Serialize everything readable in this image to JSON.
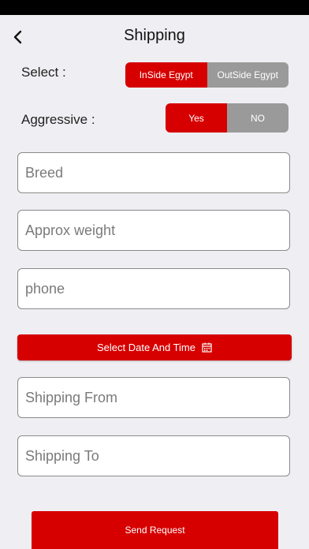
{
  "header": {
    "title": "Shipping"
  },
  "select_row": {
    "label": "Select :",
    "options": [
      "InSide Egypt",
      "OutSide Egypt"
    ],
    "selected": "InSide Egypt"
  },
  "aggressive_row": {
    "label": "Aggressive :",
    "options": [
      "Yes",
      "NO"
    ],
    "selected": "Yes"
  },
  "fields": {
    "breed": {
      "placeholder": "Breed",
      "value": ""
    },
    "weight": {
      "placeholder": "Approx weight",
      "value": ""
    },
    "phone": {
      "placeholder": "phone",
      "value": ""
    },
    "shipping_from": {
      "placeholder": "Shipping From",
      "value": ""
    },
    "shipping_to": {
      "placeholder": "Shipping To",
      "value": ""
    }
  },
  "date_button": {
    "label": "Select Date And Time",
    "icon": "calendar-icon"
  },
  "send_button": {
    "label": "Send Request"
  },
  "colors": {
    "accent": "#d60000",
    "inactive": "#9a9a9a",
    "background": "#efeff3"
  }
}
